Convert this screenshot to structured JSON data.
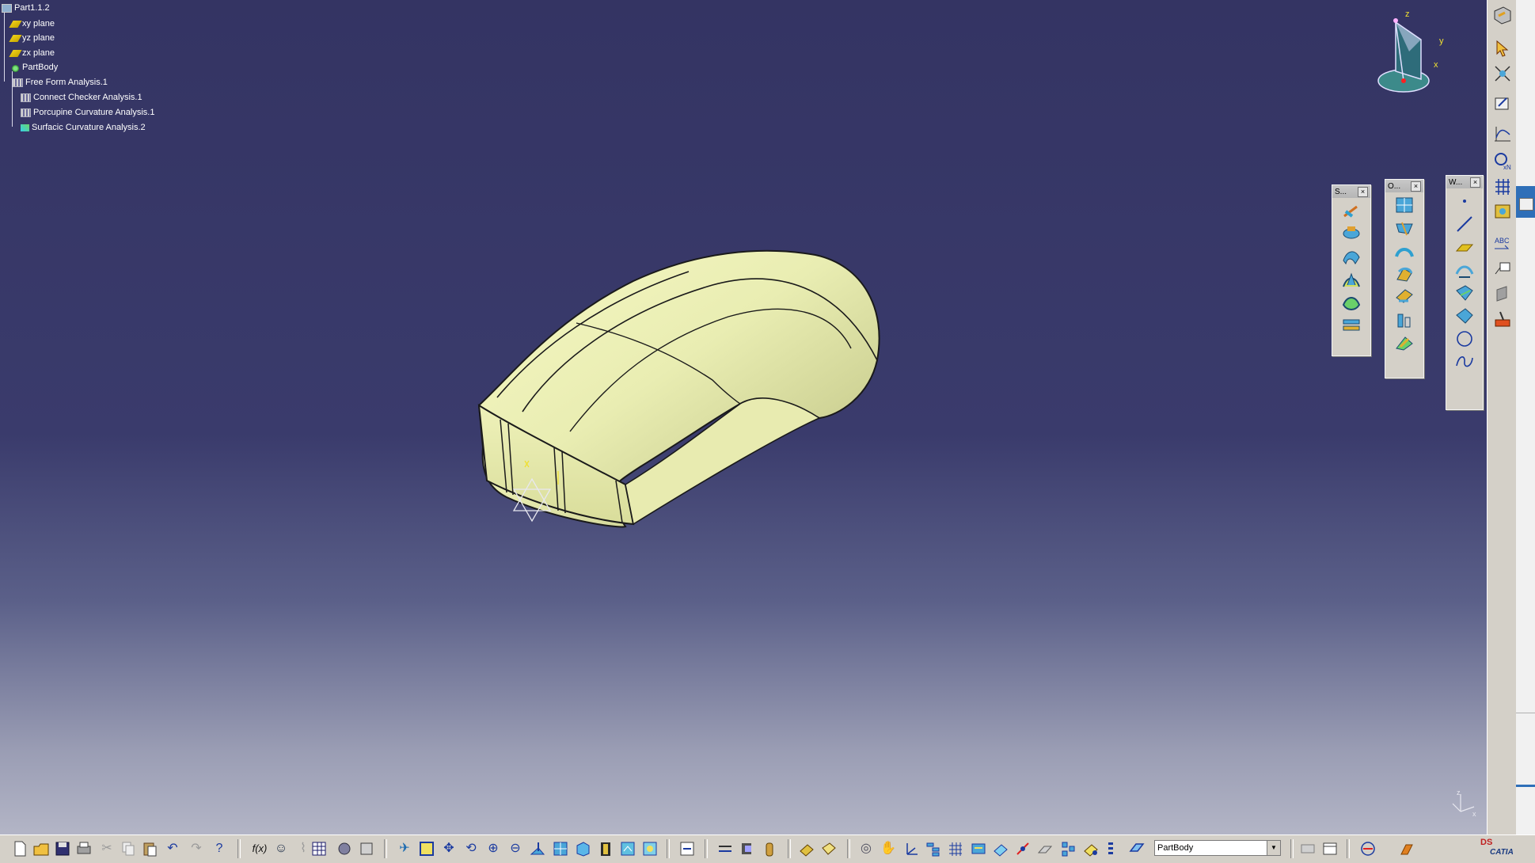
{
  "spec_tree": {
    "root": "Part1.1.2",
    "items": [
      {
        "label": "xy plane"
      },
      {
        "label": "yz plane"
      },
      {
        "label": "zx plane"
      },
      {
        "label": "PartBody"
      },
      {
        "label": "Free Form Analysis.1"
      },
      {
        "label": "Connect Checker Analysis.1"
      },
      {
        "label": "Porcupine Curvature Analysis.1"
      },
      {
        "label": "Surfacic Curvature Analysis.2"
      }
    ]
  },
  "toolbars": [
    {
      "title": "S...",
      "close": "×"
    },
    {
      "title": "O...",
      "close": "×"
    },
    {
      "title": "W...",
      "close": "×"
    }
  ],
  "compass": {
    "z": "z",
    "y": "y",
    "x": "x"
  },
  "mini_axis": {
    "z": "z",
    "x": "x"
  },
  "bottom_toolbar": {
    "fx_label": "f(x)",
    "current_body": "PartBody",
    "dropdown_arrow": "▼"
  },
  "right_toolbar": {
    "abc_label": "ABC"
  },
  "logo": {
    "ds": "DS",
    "text": "CATIA"
  }
}
